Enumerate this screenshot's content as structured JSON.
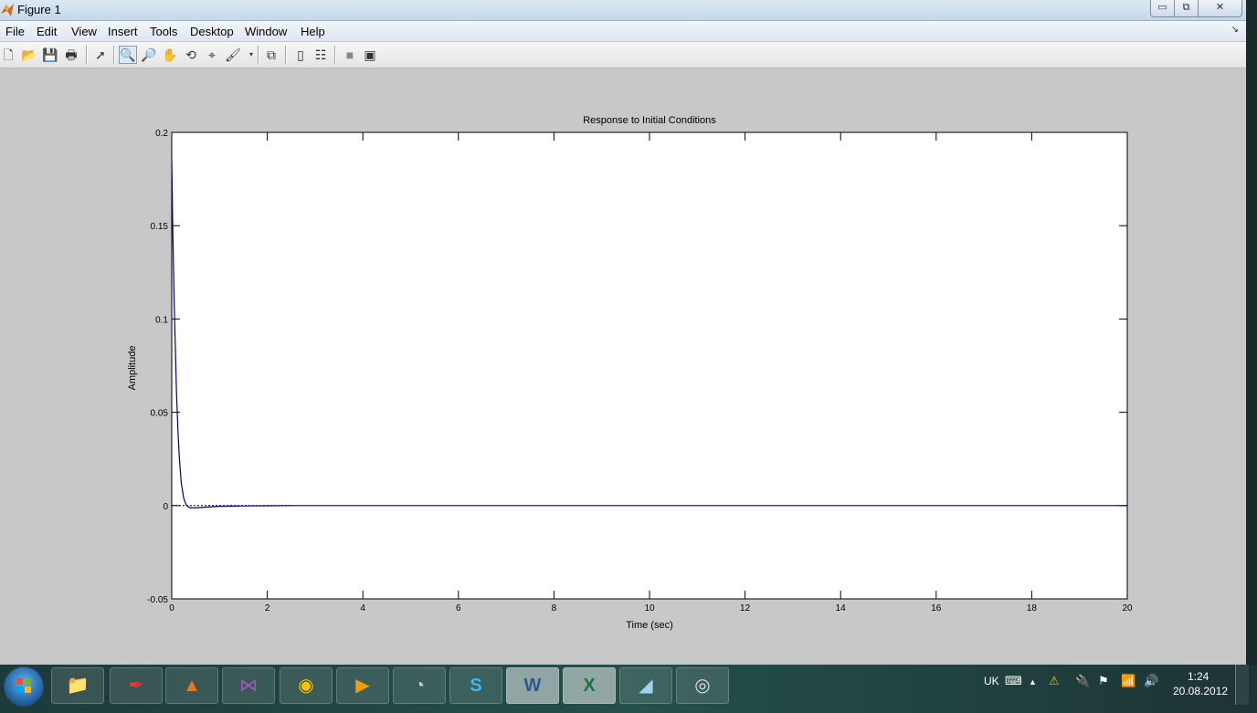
{
  "window": {
    "title": "Figure 1",
    "buttons": {
      "minimize": "▭",
      "maximize": "⧉",
      "close": "✕"
    }
  },
  "menubar": {
    "items": [
      "File",
      "Edit",
      "View",
      "Insert",
      "Tools",
      "Desktop",
      "Window",
      "Help"
    ],
    "dock_arrow": "↘"
  },
  "toolbar": {
    "icons": [
      "new-figure-icon",
      "open-file-icon",
      "save-icon",
      "print-icon",
      "select-arrow-icon",
      "zoom-in-icon",
      "zoom-out-icon",
      "pan-hand-icon",
      "rotate-3d-icon",
      "data-cursor-icon",
      "brush-icon",
      "link-plot-icon",
      "colorbar-icon",
      "legend-icon",
      "hide-plot-tools-icon",
      "show-plot-tools-icon"
    ],
    "glyphs": [
      "🗋",
      "📂",
      "💾",
      "🖶",
      "➚",
      "🔍",
      "🔎",
      "✋",
      "⟲",
      "⌖",
      "🖌",
      "⧉",
      "▯",
      "☷",
      "■",
      "▣"
    ],
    "active": "zoom-in-icon"
  },
  "chart_data": {
    "type": "line",
    "title": "Response to Initial Conditions",
    "xlabel": "Time (sec)",
    "ylabel": "Amplitude",
    "xlim": [
      0,
      20
    ],
    "ylim": [
      -0.05,
      0.2
    ],
    "xticks": [
      0,
      2,
      4,
      6,
      8,
      10,
      12,
      14,
      16,
      18,
      20
    ],
    "yticks": [
      -0.05,
      0,
      0.05,
      0.1,
      0.15,
      0.2
    ],
    "xticklabels": [
      "0",
      "2",
      "4",
      "6",
      "8",
      "10",
      "12",
      "14",
      "16",
      "18",
      "20"
    ],
    "yticklabels": [
      "-0.05",
      "0",
      "0.05",
      "0.1",
      "0.15",
      "0.2"
    ],
    "grid": false,
    "series": [
      {
        "color": "#00007f",
        "x": [
          0,
          0.02,
          0.05,
          0.08,
          0.1,
          0.13,
          0.16,
          0.2,
          0.25,
          0.3,
          0.35,
          0.4,
          0.5,
          0.6,
          0.8,
          1.0,
          1.5,
          2.0,
          2.5,
          5,
          10,
          15,
          20
        ],
        "y": [
          0.185,
          0.15,
          0.11,
          0.08,
          0.06,
          0.04,
          0.025,
          0.012,
          0.004,
          0.0005,
          -0.0008,
          -0.0012,
          -0.0012,
          -0.001,
          -0.0007,
          -0.0004,
          -0.0002,
          -0.0001,
          0,
          0,
          0,
          0,
          0
        ]
      }
    ],
    "reference_line": {
      "y": 0,
      "x_end": 2.5,
      "style": "dotted",
      "color": "#000000"
    }
  },
  "taskbar": {
    "apps": [
      {
        "name": "explorer",
        "glyph": "📁"
      },
      {
        "name": "acrobat",
        "glyph": "✒"
      },
      {
        "name": "matlab",
        "glyph": "▲"
      },
      {
        "name": "visual-studio",
        "glyph": "⋈"
      },
      {
        "name": "chrome",
        "glyph": "◉"
      },
      {
        "name": "media-player",
        "glyph": "▶"
      },
      {
        "name": "system-tool",
        "glyph": "◔"
      },
      {
        "name": "skype",
        "glyph": "S"
      },
      {
        "name": "word",
        "glyph": "W"
      },
      {
        "name": "excel",
        "glyph": "X"
      },
      {
        "name": "pen-tool",
        "glyph": "◢"
      },
      {
        "name": "speakers",
        "glyph": "◎"
      }
    ],
    "tray": {
      "language": "UK",
      "time": "1:24",
      "date": "20.08.2012"
    }
  }
}
